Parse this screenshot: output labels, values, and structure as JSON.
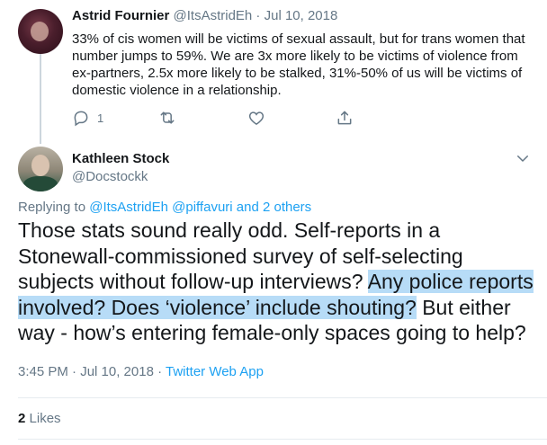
{
  "parent_tweet": {
    "author_name": "Astrid Fournier",
    "author_meta": "@ItsAstridEh · Jul 10, 2018",
    "text": "33% of cis women will be victims of sexual assault, but for trans women that number jumps to 59%. We are 3x more likely to be victims of violence from ex-partners, 2.5x more likely to be stalked, 31%-50% of us will be victims of domestic violence in a relationship.",
    "reply_count": "1"
  },
  "main_tweet": {
    "author_name": "Kathleen Stock",
    "author_handle": "@Docstockk",
    "replying_prefix": "Replying to",
    "replying_to": "@ItsAstridEh @piffavuri and 2 others",
    "text_before": "Those stats sound really odd. Self-reports in a Stonewall-commissioned survey of self-selecting subjects without follow-up interviews? ",
    "text_highlight_1": "Any police reports involved? Does ‘violence’ include shouting?",
    "text_after": " But either way - how’s entering female-only spaces going to help?",
    "timestamp": "3:45 PM · Jul 10, 2018 · ",
    "source": "Twitter Web App",
    "likes_count": "2",
    "likes_label": "Likes"
  },
  "colors": {
    "link": "#1da1f2",
    "secondary_text": "#657786",
    "highlight": "#b7dcf7"
  },
  "icons": [
    "reply-icon",
    "retweet-icon",
    "like-icon",
    "share-icon",
    "chevron-down-icon"
  ]
}
